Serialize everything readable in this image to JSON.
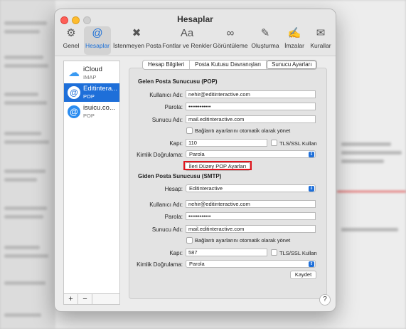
{
  "window": {
    "title": "Hesaplar"
  },
  "toolbar": [
    {
      "label": "Genel",
      "icon": "gear-icon",
      "glyph": "⚙"
    },
    {
      "label": "Hesaplar",
      "icon": "at-icon",
      "glyph": "@"
    },
    {
      "label": "İstenmeyen Posta",
      "icon": "junk-mail-icon",
      "glyph": "✖"
    },
    {
      "label": "Fontlar ve Renkler",
      "icon": "fonts-icon",
      "glyph": "Aa"
    },
    {
      "label": "Görüntüleme",
      "icon": "glasses-icon",
      "glyph": "∞"
    },
    {
      "label": "Oluşturma",
      "icon": "compose-icon",
      "glyph": "✎"
    },
    {
      "label": "İmzalar",
      "icon": "signature-icon",
      "glyph": "✍"
    },
    {
      "label": "Kurallar",
      "icon": "rules-icon",
      "glyph": "✉"
    }
  ],
  "accounts": [
    {
      "name": "iCloud",
      "type": "IMAP"
    },
    {
      "name": "Editintera...",
      "type": "POP"
    },
    {
      "name": "isuicu.co...",
      "type": "POP"
    }
  ],
  "list_footer": {
    "add": "+",
    "remove": "−"
  },
  "tabs": [
    "Hesap Bilgileri",
    "Posta Kutusu Davranışları",
    "Sunucu Ayarları"
  ],
  "incoming": {
    "title": "Gelen Posta Sunucusu (POP)",
    "username_label": "Kullanıcı Adı:",
    "username": "nehir@editinteractive.com",
    "password_label": "Parola:",
    "password": "••••••••••••",
    "server_label": "Sunucu Adı:",
    "server": "mail.editinteractive.com",
    "auto_manage": "Bağlantı ayarlarını otomatik olarak yönet",
    "port_label": "Kapı:",
    "port": "110",
    "tls": "TLS/SSL Kullan",
    "auth_label": "Kimlik Doğrulama:",
    "auth": "Parola",
    "advanced_button": "İleri Düzey POP Ayarları"
  },
  "outgoing": {
    "title": "Giden Posta Sunucusu (SMTP)",
    "account_label": "Hesap:",
    "account": "Editinteractive",
    "username_label": "Kullanıcı Adı:",
    "username": "nehir@editinteractive.com",
    "password_label": "Parola:",
    "password": "••••••••••••",
    "server_label": "Sunucu Adı:",
    "server": "mail.editinteractive.com",
    "auto_manage": "Bağlantı ayarlarını otomatik olarak yönet",
    "port_label": "Kapı:",
    "port": "587",
    "tls": "TLS/SSL Kullan",
    "auth_label": "Kimlik Doğrulama:",
    "auth": "Parola"
  },
  "save_button": "Kaydet",
  "help_button": "?",
  "colors": {
    "accent": "#1e6fd9",
    "highlight": "#e0141c"
  }
}
